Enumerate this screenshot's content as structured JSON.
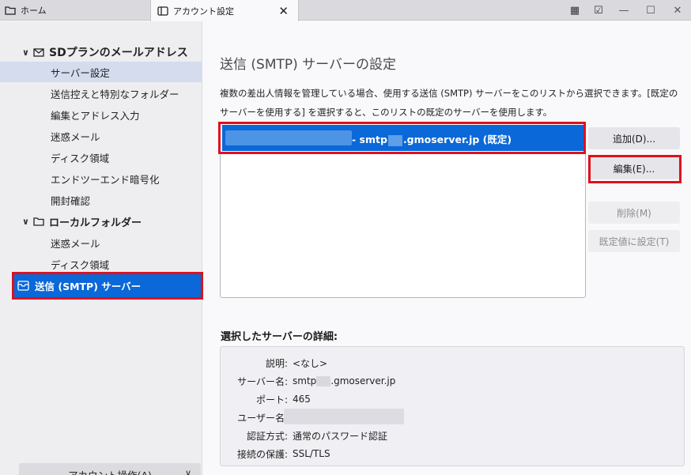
{
  "tabs": {
    "home_label": "ホーム",
    "active_label": "アカウント設定",
    "close": "✕"
  },
  "toolbar": {
    "calendar_icon": "▦",
    "tasks_icon": "☑",
    "minimize": "—",
    "maximize": "☐",
    "close": "✕"
  },
  "sidebar": {
    "account_header": "SDプランのメールアドレス",
    "account_items": [
      "サーバー設定",
      "送信控えと特別なフォルダー",
      "編集とアドレス入力",
      "迷惑メール",
      "ディスク領域",
      "エンドツーエンド暗号化",
      "開封確認"
    ],
    "local_header": "ローカルフォルダー",
    "local_items": [
      "迷惑メール",
      "ディスク領域"
    ],
    "smtp_label": "送信 (SMTP) サーバー",
    "account_actions": "アカウント操作(A)"
  },
  "main": {
    "title": "送信 (SMTP) サーバーの設定",
    "desc_line1": "複数の差出人情報を管理している場合、使用する送信 (SMTP) サーバーをこのリストから選択できます。[既定の",
    "desc_line2": "サーバーを使用する] を選択すると、このリストの既定のサーバーを使用します。",
    "server_row_prefix": "- smtp",
    "server_row_suffix": ".gmoserver.jp (既定)",
    "buttons": {
      "add": "追加(D)...",
      "edit": "編集(E)...",
      "delete": "削除(M)",
      "set_default": "既定値に設定(T)"
    },
    "details_title": "選択したサーバーの詳細:",
    "details": {
      "desc_key": "説明:",
      "desc_val": "<なし>",
      "server_key": "サーバー名:",
      "server_val_prefix": "smtp",
      "server_val_suffix": ".gmoserver.jp",
      "port_key": "ポート:",
      "port_val": "465",
      "user_key": "ユーザー名:",
      "auth_key": "認証方式:",
      "auth_val": "通常のパスワード認証",
      "sec_key": "接続の保護:",
      "sec_val": "SSL/TLS"
    }
  },
  "colors": {
    "accent": "#0a68d8",
    "highlight_box": "#e0101c"
  }
}
